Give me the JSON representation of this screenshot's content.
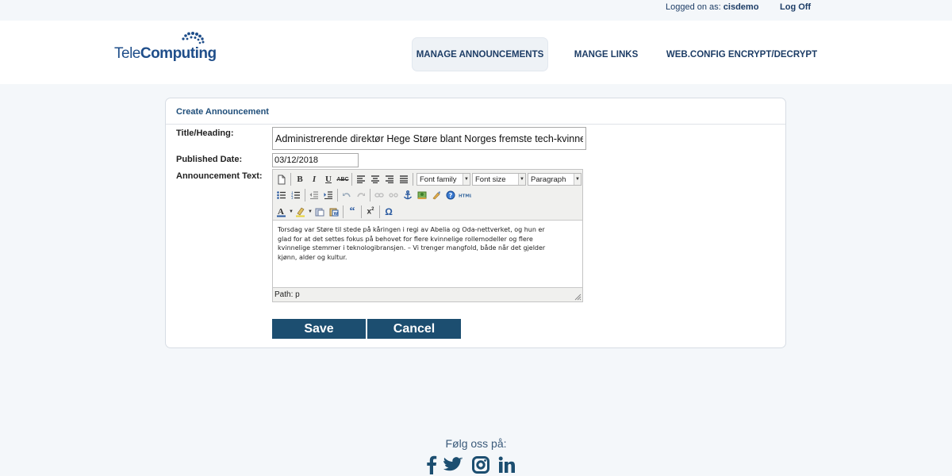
{
  "topbar": {
    "logged_prefix": "Logged on as:",
    "username": "cisdemo",
    "logoff": "Log Off"
  },
  "logo": {
    "part1": "Tele",
    "part2": "Computing"
  },
  "nav": [
    {
      "label": "MANAGE ANNOUNCEMENTS",
      "active": true
    },
    {
      "label": "MANGE LINKS",
      "active": false
    },
    {
      "label": "WEB.CONFIG ENCRYPT/DECRYPT",
      "active": false
    }
  ],
  "form": {
    "panel_title": "Create Announcement",
    "title_label": "Title/Heading:",
    "title_value": "Administrerende direktør Hege Støre blant Norges fremste tech-kvinner!",
    "date_label": "Published Date:",
    "date_value": "03/12/2018",
    "text_label": "Announcement Text:"
  },
  "editor": {
    "font_family": "Font family",
    "font_size": "Font size",
    "format": "Paragraph",
    "content_lines": [
      "Torsdag var Støre til stede på kåringen i regi av Abelia og Oda-nettverket, og hun er",
      "glad for at det settes fokus på behovet for flere kvinnelige rollemodeller og flere",
      "kvinnelige stemmer i teknologibransjen. – Vi trenger mangfold, både når det gjelder",
      "kjønn, alder og kultur."
    ],
    "path": "Path: p",
    "toolbar_icons": [
      "new-document-icon",
      "bold-icon",
      "italic-icon",
      "underline-icon",
      "strikethrough-icon",
      "align-left-icon",
      "align-center-icon",
      "align-right-icon",
      "align-justify-icon",
      "bullet-list-icon",
      "numbered-list-icon",
      "outdent-icon",
      "indent-icon",
      "undo-icon",
      "redo-icon",
      "link-icon",
      "unlink-icon",
      "anchor-icon",
      "image-icon",
      "cleanup-icon",
      "help-icon",
      "html-icon",
      "text-color-icon",
      "highlight-color-icon",
      "paste-icon",
      "paste-word-icon",
      "blockquote-icon",
      "superscript-icon",
      "special-char-icon"
    ]
  },
  "buttons": {
    "save": "Save",
    "cancel": "Cancel"
  },
  "footer": {
    "follow": "Følg oss på:",
    "social": [
      "facebook-icon",
      "twitter-icon",
      "instagram-icon",
      "linkedin-icon"
    ]
  },
  "colors": {
    "brand": "#1c4e70",
    "nav_text": "#1d3d66",
    "logo_blue": "#1f4e8a"
  }
}
